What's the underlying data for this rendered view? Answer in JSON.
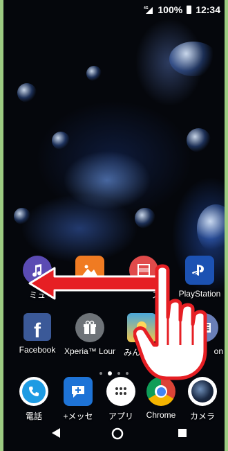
{
  "status_bar": {
    "network": "4G",
    "battery": "100%",
    "time": "12:34"
  },
  "page_indicator": {
    "count": 4,
    "active": 2
  },
  "home_row1": [
    {
      "label": "ミュ",
      "icon": "music-icon",
      "color": "#5b4bb3"
    },
    {
      "label": "",
      "icon": "album-icon",
      "color": "#f07b22"
    },
    {
      "label": "ス",
      "icon": "video-icon",
      "color": "#e04a4a"
    },
    {
      "label": "PlayStation",
      "icon": "playstation-icon",
      "color": "#1c52b3"
    }
  ],
  "home_row2": [
    {
      "label": "Facebook",
      "icon": "facebook-icon",
      "color": "#3b5998"
    },
    {
      "label": "Xperia™ Loun",
      "icon": "gift-icon",
      "color": "#6e7378"
    },
    {
      "label": "みん",
      "icon": "game-icon",
      "color": "#4aa7d9"
    },
    {
      "label": "on",
      "icon": "news-icon",
      "color": "#6a7fb8"
    }
  ],
  "dock": [
    {
      "label": "電話",
      "icon": "phone-icon",
      "color": "#1e9be3"
    },
    {
      "label": "+メッセ",
      "icon": "message-icon",
      "color": "#1e73d6"
    },
    {
      "label": "アプリ",
      "icon": "apps-grid-icon",
      "color": "#ffffff"
    },
    {
      "label": "Chrome",
      "icon": "chrome-icon",
      "color": "#ffffff"
    },
    {
      "label": "カメラ",
      "icon": "camera-icon",
      "color": "#ffffff"
    }
  ],
  "colors": {
    "frame": "#9dcb83",
    "arrow": "#e61f24",
    "hand_outline": "#e61f24"
  }
}
